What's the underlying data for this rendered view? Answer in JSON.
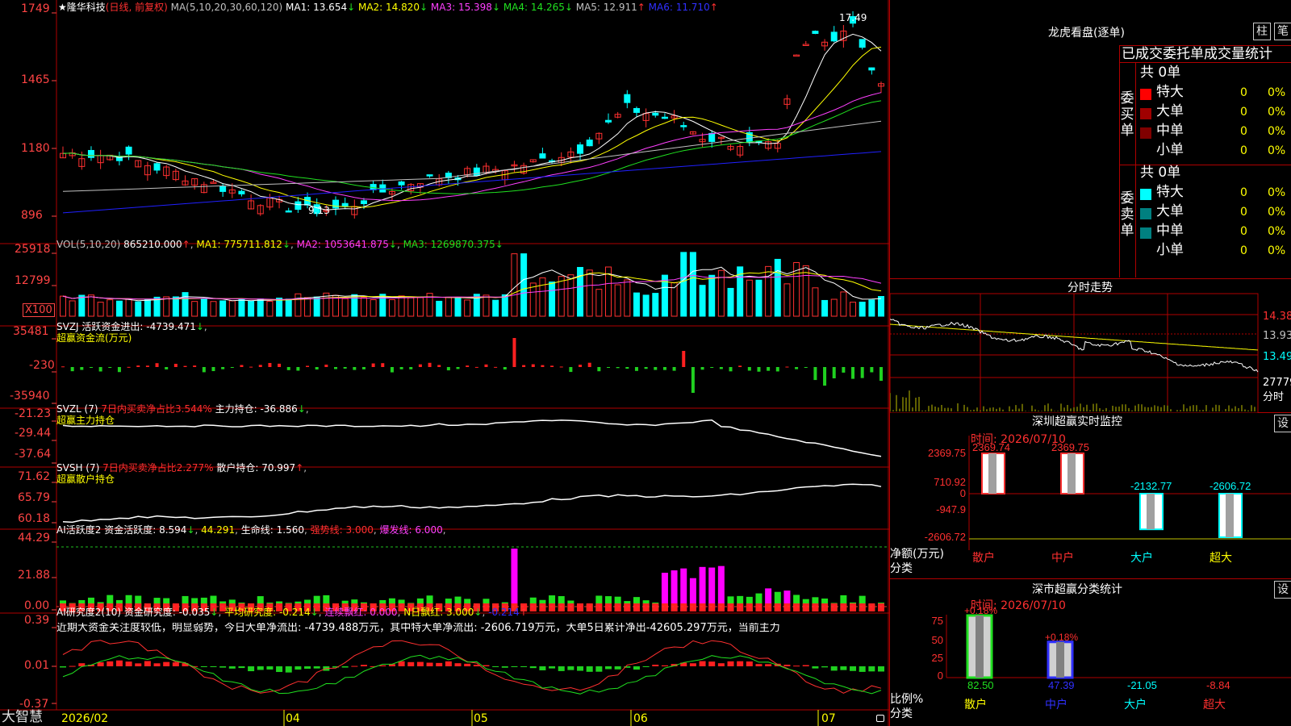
{
  "colors": {
    "up": "#ff3030",
    "down": "#00ffff",
    "grid": "#b00000",
    "axis": "#ff4444",
    "ma1": "#ffffff",
    "ma2": "#ffff00",
    "ma3": "#ff40ff",
    "ma4": "#20e020",
    "ma5": "#c0c0c0",
    "ma6": "#2020ff"
  },
  "main": {
    "title": "★隆华科技",
    "mode": "(日线, 前复权)",
    "ma_label": "MA(5,10,20,30,60,120)",
    "ma_values": [
      {
        "label": "MA1: 13.654",
        "arrow": "↓",
        "color": "#ffffff"
      },
      {
        "label": "MA2: 14.820",
        "arrow": "↓",
        "color": "#ffff00"
      },
      {
        "label": "MA3: 15.398",
        "arrow": "↓",
        "color": "#ff40ff"
      },
      {
        "label": "MA4: 14.265",
        "arrow": "↓",
        "color": "#20e020"
      },
      {
        "label": "MA5: 12.911",
        "arrow": "↑",
        "color": "#c0c0c0"
      },
      {
        "label": "MA6: 11.710",
        "arrow": "↑",
        "color": "#3030ff"
      }
    ],
    "yticks": [
      "1749",
      "1465",
      "1180",
      "896"
    ],
    "hi_label": "17.49",
    "lo_label": "9.13"
  },
  "vol": {
    "label": "VOL(5,10,20)",
    "value": "865210.000",
    "ma1": "MA1: 775711.812",
    "ma2": "MA2: 1053641.875",
    "ma3": "MA3: 1269870.375",
    "yticks": [
      "25918",
      "12799"
    ],
    "unit": "X100"
  },
  "svzj": {
    "label": "SVZJ  活跃资金进出: -4739.471",
    "sub": "超赢资金流(万元)",
    "yticks": [
      "35481",
      "-230",
      "-35940"
    ]
  },
  "svzl": {
    "label": "SVZL (7)",
    "seg1": "7日内买卖净占比3.544%",
    "seg2": "主力持仓: -36.886",
    "sub": "超赢主力持仓",
    "yticks": [
      "-21.23",
      "-29.44",
      "-37.64"
    ]
  },
  "svsh": {
    "label": "SVSH (7)",
    "seg1": "7日内买卖净占比2.277%",
    "seg2": "散户持仓: 70.997",
    "sub": "超赢散户持仓",
    "yticks": [
      "71.62",
      "65.79",
      "60.18"
    ]
  },
  "ai1": {
    "label": "AI活跃度2",
    "seg1": "资金活跃度: 8.594",
    "seg2": "44.291",
    "seg3": "生命线: 1.560",
    "seg4": "强势线: 3.000",
    "seg5": "爆发线: 6.000",
    "yticks": [
      "44.29",
      "21.88",
      "0.00"
    ]
  },
  "ai2": {
    "label": "AI研究度2(10)",
    "seg1": "资金研究度: -0.035",
    "seg2": "平均研究度: -0.214",
    "seg3": "连续飘红: 0.000",
    "seg4": "N日飘红: 3.000",
    "seg5": "-0.214",
    "text": "近期大资金关注度较低，明显弱势，今日大单净流出: -4739.488万元，其中特大单净流出: -2606.719万元，大单5日累计净出-42605.297万元，当前主力",
    "yticks": [
      "0.39",
      "0.01",
      "-0.37"
    ]
  },
  "xaxis": {
    "logo": "大智慧",
    "labels": [
      "2026/02",
      "04",
      "05",
      "06",
      "07"
    ]
  },
  "longhu": {
    "title": "龙虎看盘(逐单)",
    "btn1": "柱",
    "btn2": "笔",
    "header": "已成交委托单成交量统计",
    "buy_label": "委买单",
    "sell_label": "委卖单",
    "buy_total": "共 0单",
    "sell_total": "共 0单",
    "buy_rows": [
      {
        "name": "特大",
        "n": "0",
        "p": "0%"
      },
      {
        "name": "大单",
        "n": "0",
        "p": "0%"
      },
      {
        "name": "中单",
        "n": "0",
        "p": "0%"
      },
      {
        "name": "小单",
        "n": "0",
        "p": "0%"
      }
    ],
    "sell_rows": [
      {
        "name": "特大",
        "n": "0",
        "p": "0%"
      },
      {
        "name": "大单",
        "n": "0",
        "p": "0%"
      },
      {
        "name": "中单",
        "n": "0",
        "p": "0%"
      },
      {
        "name": "小单",
        "n": "0",
        "p": "0%"
      }
    ]
  },
  "fenshi": {
    "title": "分时走势",
    "p1": "14.38",
    "p2": "13.93",
    "p3": "13.49",
    "vol": "27779",
    "unit": "分时"
  },
  "monitor": {
    "title": "深圳超赢实时监控",
    "btn": "设",
    "time": "时间: 2026/07/10",
    "yticks": [
      "2369.75",
      "710.92",
      "0",
      "-947.9",
      "-2606.72"
    ],
    "bar_labels": [
      "2369.74",
      "2369.75",
      "-2132.77",
      "-2606.72"
    ],
    "ylabel1": "净额(万元)",
    "ylabel2": "分类",
    "cats": [
      "散户",
      "中户",
      "大户",
      "超大"
    ]
  },
  "classify": {
    "title": "深市超赢分类统计",
    "btn": "设",
    "time": "时间: 2026/07/10",
    "yticks": [
      "75",
      "50",
      "25",
      "0"
    ],
    "top_labels": [
      "+0.18%",
      "+0.18%"
    ],
    "vals": [
      "82.50",
      "47.39",
      "-21.05",
      "-8.84"
    ],
    "ylabel1": "比例%",
    "ylabel2": "分类",
    "cats": [
      "散户",
      "中户",
      "大户",
      "超大"
    ]
  }
}
